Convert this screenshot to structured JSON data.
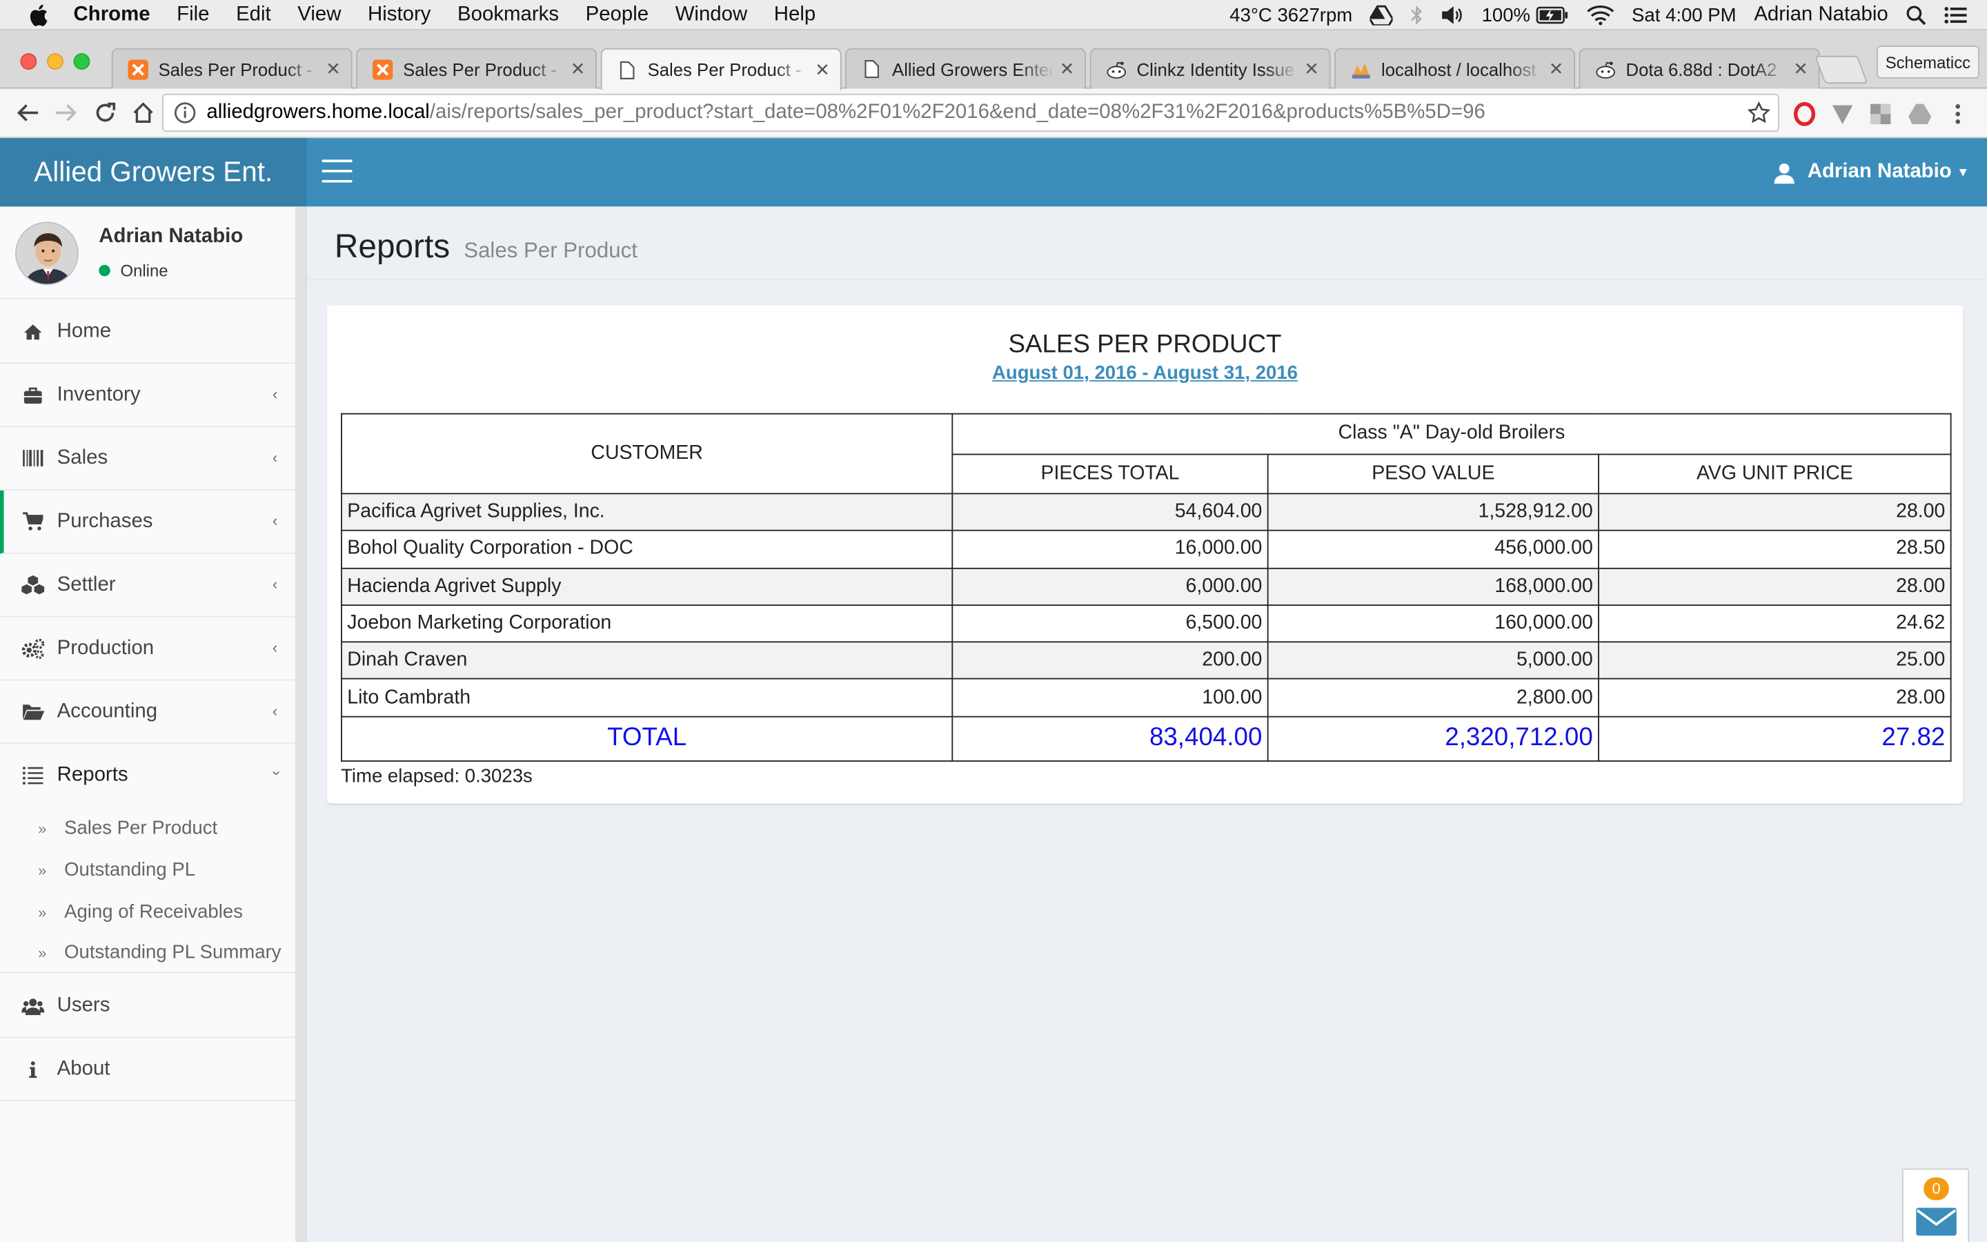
{
  "macos_menubar": {
    "app_name": "Chrome",
    "menus": [
      "File",
      "Edit",
      "View",
      "History",
      "Bookmarks",
      "People",
      "Window",
      "Help"
    ],
    "status": {
      "temp_fan": "43°C 3627rpm",
      "battery": "100%",
      "clock": "Sat 4:00 PM",
      "user": "Adrian Natabio"
    }
  },
  "browser": {
    "tabs": [
      {
        "title": "Sales Per Product - R",
        "icon": "xampp-icon",
        "active": false
      },
      {
        "title": "Sales Per Product - R",
        "icon": "xampp-icon",
        "active": false
      },
      {
        "title": "Sales Per Product - R",
        "icon": "document-icon",
        "active": true
      },
      {
        "title": "Allied Growers Enterp",
        "icon": "document-icon",
        "active": false
      },
      {
        "title": "Clinkz Identity Issue :",
        "icon": "reddit-icon",
        "active": false
      },
      {
        "title": "localhost / localhost /",
        "icon": "phpmyadmin-icon",
        "active": false
      },
      {
        "title": "Dota 6.88d : DotA2",
        "icon": "reddit-icon",
        "active": false
      }
    ],
    "profile_button": "Schematicc",
    "url_host": "alliedgrowers.home.local",
    "url_path": "/ais/reports/sales_per_product?start_date=08%2F01%2F2016&end_date=08%2F31%2F2016&products%5B%5D=96"
  },
  "app": {
    "brand": "Allied Growers Ent.",
    "header_user": "Adrian Natabio",
    "colors": {
      "header": "#3c8dbc",
      "logo_bg": "#367fa9",
      "online": "#00a65a",
      "total_text": "#1010e6"
    }
  },
  "sidebar": {
    "user_name": "Adrian Natabio",
    "user_status": "Online",
    "items": [
      {
        "label": "Home",
        "icon": "home-icon"
      },
      {
        "label": "Inventory",
        "icon": "briefcase-icon"
      },
      {
        "label": "Sales",
        "icon": "barcode-icon"
      },
      {
        "label": "Purchases",
        "icon": "cart-icon"
      },
      {
        "label": "Settler",
        "icon": "cubes-icon"
      },
      {
        "label": "Production",
        "icon": "gears-icon"
      },
      {
        "label": "Accounting",
        "icon": "folder-open-icon"
      },
      {
        "label": "Reports",
        "icon": "list-icon"
      },
      {
        "label": "Users",
        "icon": "users-icon"
      },
      {
        "label": "About",
        "icon": "info-icon"
      }
    ],
    "reports_sub": [
      "Sales Per Product",
      "Outstanding PL",
      "Aging of Receivables",
      "Outstanding PL Summary"
    ]
  },
  "page": {
    "title": "Reports",
    "subtitle": "Sales Per Product"
  },
  "report": {
    "title": "SALES PER PRODUCT",
    "date_range": "August 01, 2016 - August 31, 2016",
    "headers": {
      "customer": "CUSTOMER",
      "product": "Class \"A\" Day-old Broilers",
      "pieces": "PIECES TOTAL",
      "peso": "PESO VALUE",
      "avg": "AVG UNIT PRICE"
    },
    "rows": [
      {
        "customer": "Pacifica Agrivet Supplies, Inc.",
        "pieces": "54,604.00",
        "peso": "1,528,912.00",
        "avg": "28.00"
      },
      {
        "customer": "Bohol Quality Corporation - DOC",
        "pieces": "16,000.00",
        "peso": "456,000.00",
        "avg": "28.50"
      },
      {
        "customer": "Hacienda Agrivet Supply",
        "pieces": "6,000.00",
        "peso": "168,000.00",
        "avg": "28.00"
      },
      {
        "customer": "Joebon Marketing Corporation",
        "pieces": "6,500.00",
        "peso": "160,000.00",
        "avg": "24.62"
      },
      {
        "customer": "Dinah Craven",
        "pieces": "200.00",
        "peso": "5,000.00",
        "avg": "25.00"
      },
      {
        "customer": "Lito Cambrath",
        "pieces": "100.00",
        "peso": "2,800.00",
        "avg": "28.00"
      }
    ],
    "total": {
      "label": "TOTAL",
      "pieces": "83,404.00",
      "peso": "2,320,712.00",
      "avg": "27.82"
    },
    "elapsed": "Time elapsed: 0.3023s"
  },
  "mail_widget": {
    "count": "0"
  }
}
